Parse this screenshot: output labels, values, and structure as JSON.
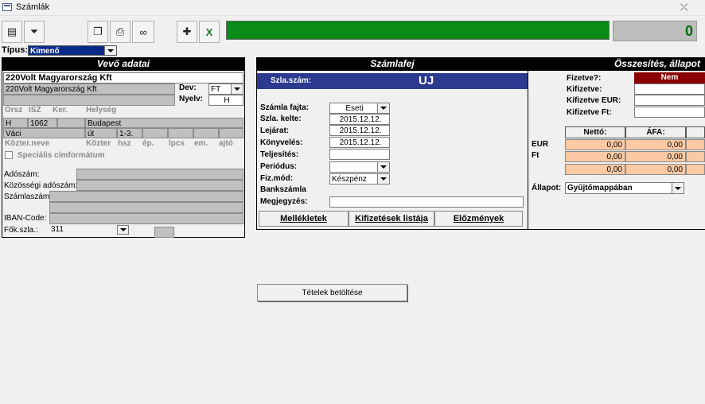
{
  "window": {
    "title": "Számlák"
  },
  "toolbar": {
    "counter": "0"
  },
  "tipus": {
    "label": "Típus:",
    "value": "Kimenő"
  },
  "vevo": {
    "header": "Vevő adatai",
    "name": "220Volt Magyarország Kft",
    "name2": "220Volt Magyarország Kft",
    "dev_label": "Dev:",
    "dev_value": "FT",
    "nyelv_label": "Nyelv:",
    "nyelv_value": "H",
    "addr_headers": [
      "Orsz",
      "ISZ",
      "Ker.",
      "Helység"
    ],
    "orsz": "H",
    "isz": "1062",
    "ker": "",
    "helyseg": "Budapest",
    "kozter_neve": "Váci",
    "kozter": "út",
    "hsz": "1-3.",
    "addr_footers": [
      "Közter.neve",
      "Közter",
      "hsz",
      "ép.",
      "lpcs",
      "em.",
      "ajtó"
    ],
    "specialis_label": "Speciális címformátum",
    "adoszam_label": "Adószám:",
    "kozossegi_label": "Közösségi adószám:",
    "szamlaszam_label": "Számlaszám:",
    "iban_label": "IBAN-Code:",
    "fok_label": "Fők.szla.:",
    "fok_value": "311"
  },
  "szamlafej": {
    "header": "Számlafej",
    "szla_szam_label": "Szla.szám:",
    "szla_szam_value": "UJ",
    "fajta_label": "Számla fajta:",
    "fajta_value": "Eseti",
    "kelte_label": "Szla. kelte:",
    "kelte_value": "2015.12.12.",
    "lejarat_label": "Lejárat:",
    "lejarat_value": "2015.12.12.",
    "konyveles_label": "Könyvelés:",
    "konyveles_value": "2015.12.12.",
    "teljesites_label": "Teljesítés:",
    "periodus_label": "Periódus:",
    "fizmod_label": "Fiz.mód:",
    "fizmod_value": "Készpénz",
    "bankszamla_label": "Bankszámla",
    "megjegyzes_label": "Megjegyzés:",
    "btn_mellekletek": "Mellékletek",
    "btn_kifizetesek": "Kifizetések listája",
    "btn_elozmenyek": "Előzmények"
  },
  "osszesites": {
    "header": "Összesítés, állapot",
    "fizetve_label": "Fizetve?:",
    "fizetve_value": "Nem",
    "kifizetve_label": "Kifizetve:",
    "kifizetve_eur_label": "Kifizetve EUR:",
    "kifizetve_ft_label": "Kifizetve Ft:",
    "col_netto": "Nettó:",
    "col_afa": "ÁFA:",
    "row_eur": "EUR",
    "row_ft": "Ft",
    "rows": [
      [
        "0,00",
        "0,00"
      ],
      [
        "0,00",
        "0,00"
      ],
      [
        "0,00",
        "0,00"
      ]
    ],
    "allapot_label": "Állapot:",
    "allapot_value": "Gyűjtőmappában"
  },
  "tetelek_button": "Tételek betöltése",
  "colors": {
    "progress": "#0a8a17",
    "header_bg": "#000000",
    "szlaszam_bar": "#2b3a8f",
    "nem_bg": "#8b0000",
    "orange": "#fbc9a3"
  }
}
